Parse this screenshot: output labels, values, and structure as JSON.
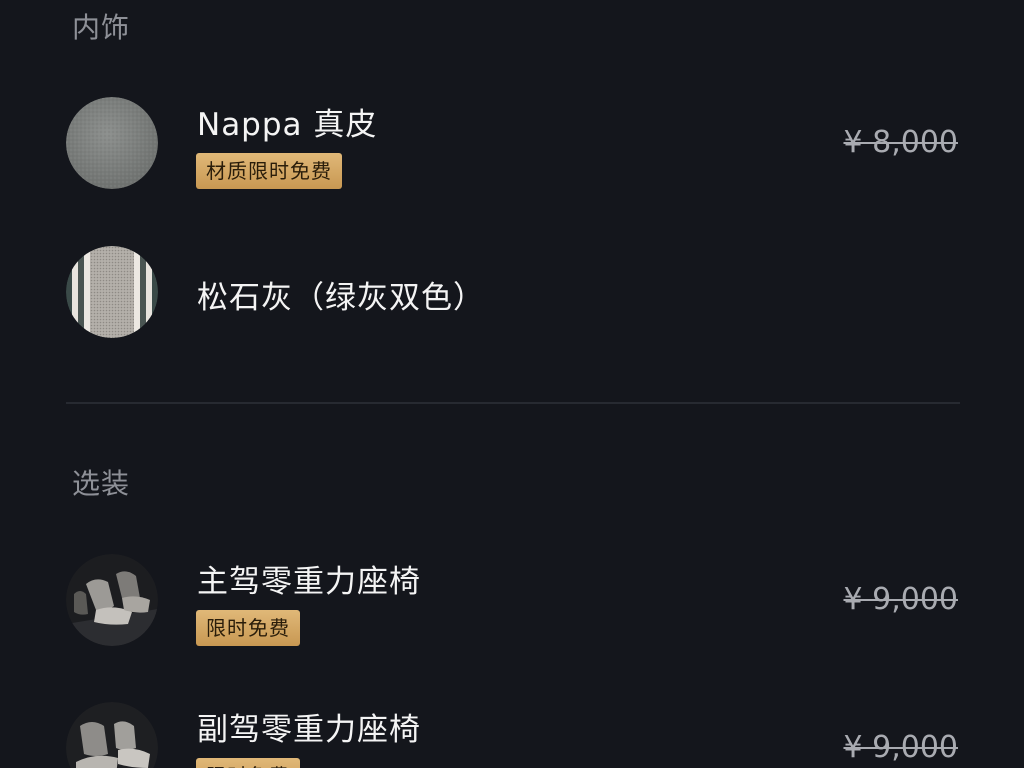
{
  "interior": {
    "section_title": "内饰",
    "items": [
      {
        "name": "Nappa 真皮",
        "badge": "材质限时免费",
        "price": "¥ 8,000",
        "thumb_icon": "leather-swatch-icon"
      },
      {
        "name": "松石灰（绿灰双色）",
        "thumb_icon": "striped-fabric-swatch-icon"
      }
    ]
  },
  "options": {
    "section_title": "选装",
    "items": [
      {
        "name": "主驾零重力座椅",
        "badge": "限时免费",
        "price": "¥ 9,000",
        "thumb_icon": "driver-seat-photo-icon"
      },
      {
        "name": "副驾零重力座椅",
        "badge": "限时免费",
        "price": "¥ 9,000",
        "thumb_icon": "passenger-seat-photo-icon"
      }
    ]
  },
  "colors": {
    "background": "#14161c",
    "badge_gold": "#d8ad68",
    "section_title_gray": "#8e9097",
    "price_gray": "#a9abb1"
  }
}
